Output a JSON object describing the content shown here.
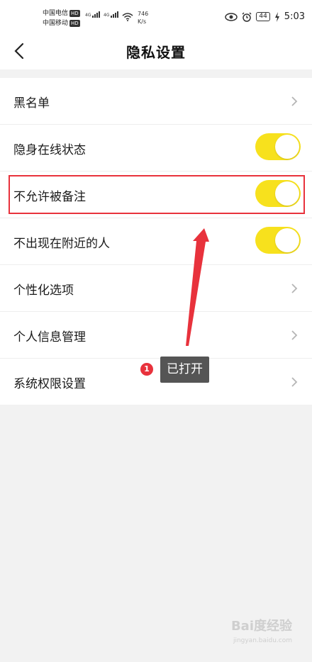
{
  "status_bar": {
    "carrier1": "中国电信",
    "carrier2": "中国移动",
    "hd": "HD",
    "net1": "4G",
    "net2": "4G",
    "speed_value": "746",
    "speed_unit": "K/s",
    "battery": "44",
    "time": "5:03"
  },
  "header": {
    "title": "隐私设置"
  },
  "settings": [
    {
      "label": "黑名单",
      "control": "chevron"
    },
    {
      "label": "隐身在线状态",
      "control": "toggle",
      "on": true
    },
    {
      "label": "不允许被备注",
      "control": "toggle",
      "on": true
    },
    {
      "label": "不出现在附近的人",
      "control": "toggle",
      "on": true
    },
    {
      "label": "个性化选项",
      "control": "chevron"
    },
    {
      "label": "个人信息管理",
      "control": "chevron"
    },
    {
      "label": "系统权限设置",
      "control": "chevron"
    }
  ],
  "annotation": {
    "step": "1",
    "text": "已打开"
  },
  "watermark": {
    "brand": "Bai度经验",
    "url": "jingyan.baidu.com"
  },
  "colors": {
    "toggle_on": "#f7e11d",
    "highlight": "#e8323c",
    "tooltip_bg": "#555555"
  }
}
